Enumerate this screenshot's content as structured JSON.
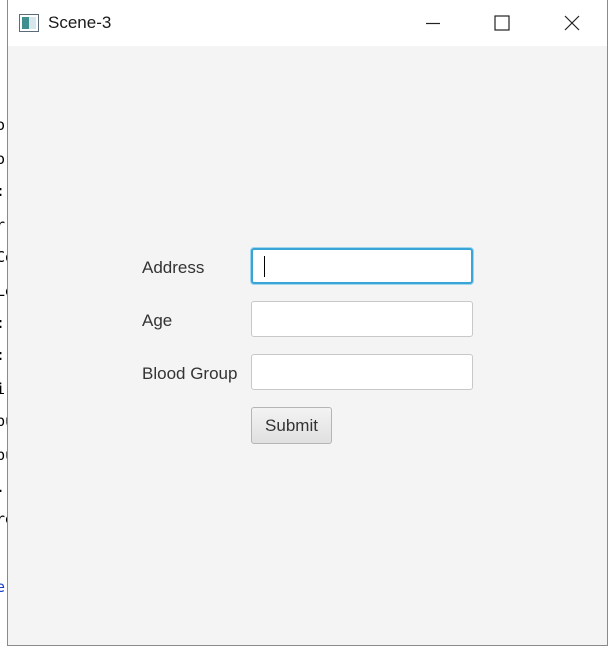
{
  "window": {
    "title": "Scene-3",
    "icon": "java-app-icon",
    "controls": {
      "minimize_icon": "minimize-icon",
      "maximize_icon": "maximize-icon",
      "close_icon": "close-icon"
    }
  },
  "form": {
    "fields": [
      {
        "label": "Address",
        "value": "",
        "focused": true
      },
      {
        "label": "Age",
        "value": "",
        "focused": false
      },
      {
        "label": "Blood Group",
        "value": "",
        "focused": false
      }
    ],
    "submit_label": "Submit"
  },
  "background": {
    "fragments": [
      "or",
      "o",
      ":",
      "r",
      "Co",
      "Le",
      ":",
      ":",
      "i",
      "bu",
      "bu",
      ".",
      "re",
      "e"
    ]
  },
  "colors": {
    "focus_border": "#3aa4d6",
    "window_bg": "#f4f4f4",
    "titlebar_bg": "#ffffff"
  }
}
